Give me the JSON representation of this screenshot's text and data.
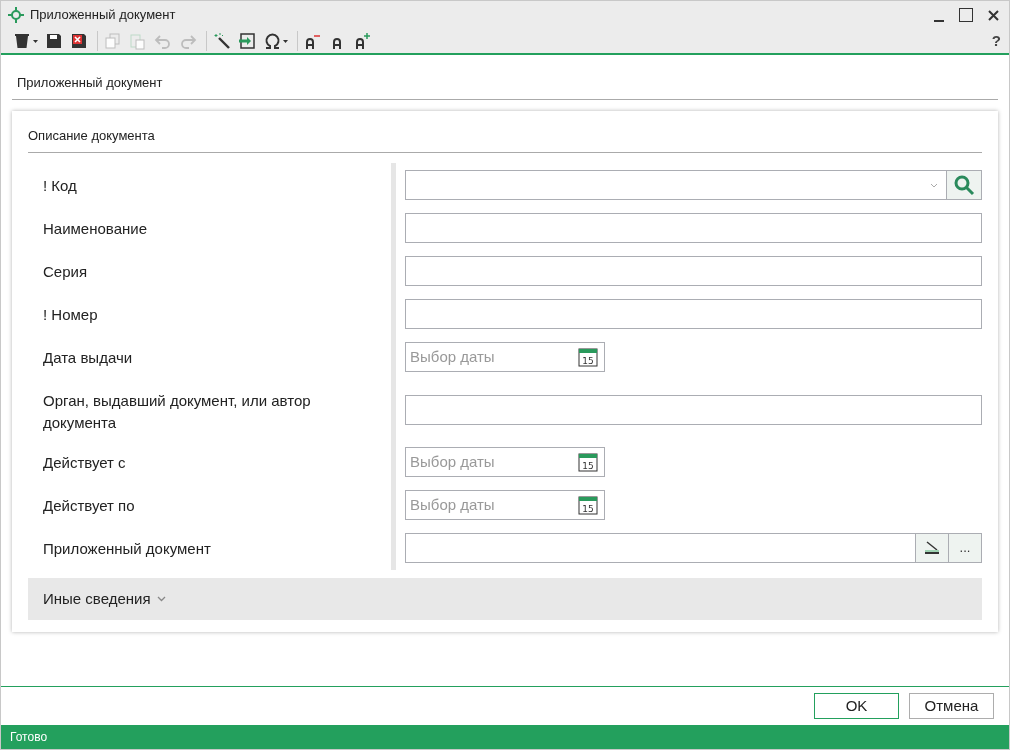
{
  "window": {
    "title": "Приложенный документ"
  },
  "toolbar": [
    {
      "kind": "trash",
      "disabled": false,
      "dropdown": true
    },
    {
      "kind": "save",
      "disabled": false,
      "dropdown": false
    },
    {
      "kind": "close-doc",
      "disabled": false,
      "dropdown": false
    },
    {
      "kind": "sep"
    },
    {
      "kind": "copy",
      "disabled": true,
      "dropdown": false
    },
    {
      "kind": "paste",
      "disabled": true,
      "dropdown": false
    },
    {
      "kind": "undo",
      "disabled": true,
      "dropdown": false
    },
    {
      "kind": "redo",
      "disabled": true,
      "dropdown": false
    },
    {
      "kind": "sep"
    },
    {
      "kind": "wand",
      "disabled": false,
      "dropdown": false
    },
    {
      "kind": "insert",
      "disabled": false,
      "dropdown": false
    },
    {
      "kind": "omega",
      "disabled": false,
      "dropdown": true
    },
    {
      "kind": "sep"
    },
    {
      "kind": "font-smaller",
      "disabled": false,
      "dropdown": false
    },
    {
      "kind": "font-normal",
      "disabled": false,
      "dropdown": false
    },
    {
      "kind": "font-larger",
      "disabled": false,
      "dropdown": false
    }
  ],
  "help": "?",
  "section_title": "Приложенный документ",
  "card": {
    "title": "Описание документа",
    "fields": [
      {
        "kind": "combo",
        "label": "! Код"
      },
      {
        "kind": "text",
        "label": "Наименование"
      },
      {
        "kind": "text",
        "label": "Серия"
      },
      {
        "kind": "text",
        "label": "! Номер"
      },
      {
        "kind": "date",
        "label": "Дата выдачи",
        "placeholder": "Выбор даты",
        "calendar_day": "15"
      },
      {
        "kind": "text",
        "label": "Орган, выдавший документ, или автор документа"
      },
      {
        "kind": "date",
        "label": "Действует с",
        "placeholder": "Выбор даты",
        "calendar_day": "15"
      },
      {
        "kind": "date",
        "label": "Действует по",
        "placeholder": "Выбор даты",
        "calendar_day": "15"
      },
      {
        "kind": "file",
        "label": "Приложенный документ",
        "browse": "..."
      }
    ],
    "expander": {
      "label": "Иные сведения",
      "expanded": false
    }
  },
  "buttons": [
    {
      "label": "OK",
      "default": true
    },
    {
      "label": "Отмена",
      "default": false
    }
  ],
  "status_bar": "Готово"
}
